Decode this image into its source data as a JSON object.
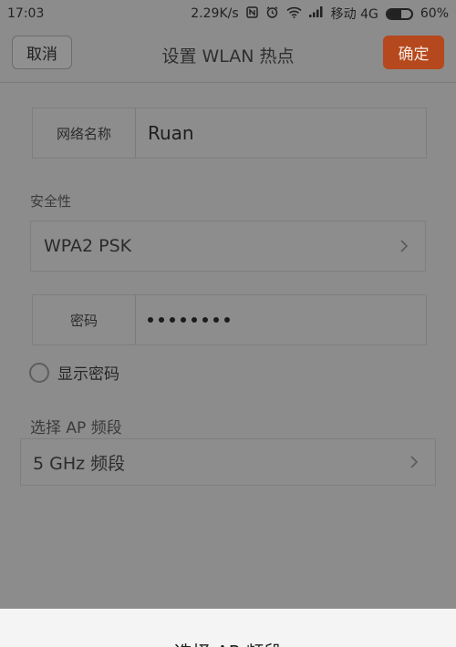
{
  "status_bar": {
    "time": "17:03",
    "net_speed": "2.29K/s",
    "carrier": "移动 4G",
    "battery_text": "60%",
    "battery_level": 0.6
  },
  "header": {
    "cancel_label": "取消",
    "title": "设置 WLAN 热点",
    "confirm_label": "确定"
  },
  "form": {
    "network_name_label": "网络名称",
    "network_name_value": "Ruan",
    "security_label": "安全性",
    "security_value": "WPA2 PSK",
    "password_label": "密码",
    "show_password_label": "显示密码",
    "ap_band_label": "选择 AP 频段",
    "ap_band_value": "5 GHz 频段"
  },
  "bottom_sheet": {
    "title": "选择 AP 频段"
  },
  "colors": {
    "accent": "#b5481d",
    "dim_overlay": "#8c8c8c"
  }
}
